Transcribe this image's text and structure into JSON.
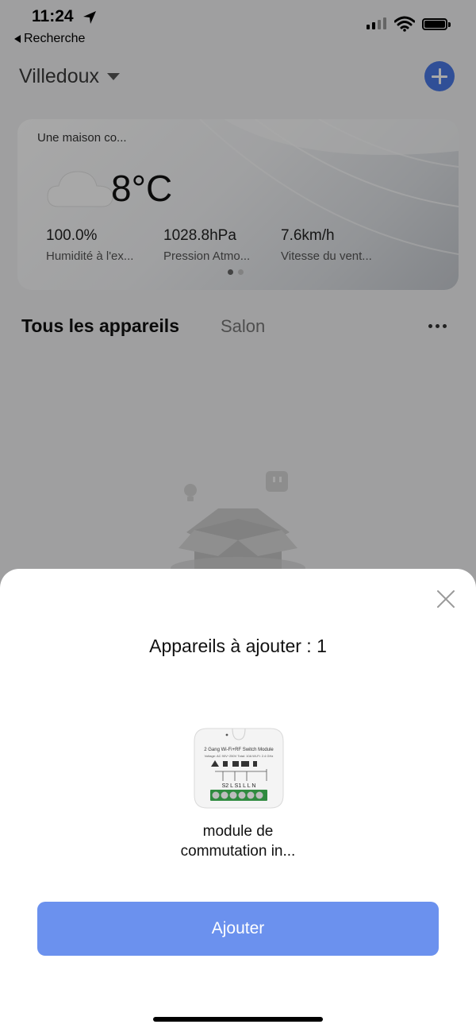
{
  "status_bar": {
    "time": "11:24",
    "back_label": "Recherche"
  },
  "header": {
    "home_name": "Villedoux"
  },
  "weather": {
    "title": "Une maison co...",
    "temperature": "8°C",
    "stats": [
      {
        "value": "100.0%",
        "label": "Humidité à l'ex..."
      },
      {
        "value": "1028.8hPa",
        "label": "Pression Atmo..."
      },
      {
        "value": "7.6km/h",
        "label": "Vitesse du vent..."
      }
    ]
  },
  "tabs": {
    "all": "Tous les appareils",
    "room": "Salon"
  },
  "sheet": {
    "title": "Appareils à ajouter : 1",
    "device": {
      "name": "module de commutation in...",
      "module_text": "2 Gang Wi-Fi+RF Switch Module",
      "spec_text": "Voltage: AC 90V~250V  Total: 10A  Wi-Fi: 2.4 GHz",
      "terminals": "S2  L  S1  L  L  N"
    },
    "add_button": "Ajouter"
  },
  "colors": {
    "accent": "#4a78e6",
    "add_button": "#6b91ee"
  },
  "icons": [
    "location-arrow-icon",
    "back-arrow-icon",
    "signal-icon",
    "wifi-icon",
    "battery-icon",
    "dropdown-caret-icon",
    "plus-icon",
    "cloud-icon",
    "more-icon",
    "close-icon"
  ]
}
